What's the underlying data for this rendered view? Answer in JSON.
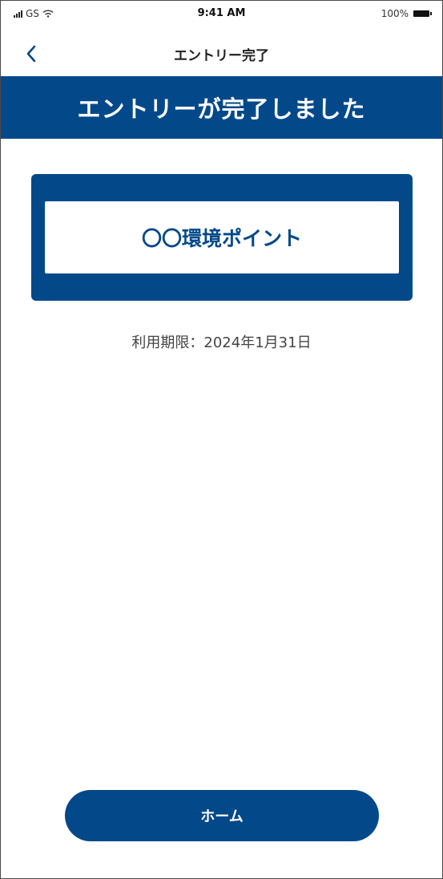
{
  "status_bar": {
    "carrier": "GS",
    "time": "9:41 AM",
    "battery": "100%"
  },
  "nav": {
    "title": "エントリー完了"
  },
  "banner": {
    "message": "エントリーが完了しました"
  },
  "card": {
    "points_name": "〇〇環境ポイント"
  },
  "expiry": {
    "text": "利用期限：2024年1月31日"
  },
  "footer": {
    "home_label": "ホーム"
  },
  "colors": {
    "primary": "#03498a",
    "background": "#ffffff"
  },
  "icons": {
    "back": "chevron-left-icon",
    "signal": "signal-icon",
    "wifi": "wifi-icon",
    "battery": "battery-icon"
  }
}
